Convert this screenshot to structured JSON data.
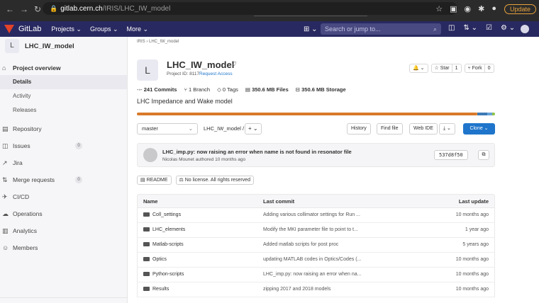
{
  "browser": {
    "url_host": "gitlab.cern.ch",
    "url_path": "/IRIS/LHC_IW_model",
    "update_label": "Update"
  },
  "header": {
    "brand": "GitLab",
    "menu": [
      "Projects ⌄",
      "Groups ⌄",
      "More ⌄"
    ],
    "search_placeholder": "Search or jump to..."
  },
  "sidebar": {
    "avatar_letter": "L",
    "project_name": "LHC_IW_model",
    "items": [
      {
        "label": "Project overview",
        "icon": "home-icon",
        "glyph": "⌂"
      },
      {
        "label": "Details"
      },
      {
        "label": "Activity"
      },
      {
        "label": "Releases"
      },
      {
        "label": "Repository",
        "icon": "doc-icon",
        "glyph": "▤"
      },
      {
        "label": "Issues",
        "icon": "issues-icon",
        "glyph": "◫",
        "count": "0"
      },
      {
        "label": "Jira",
        "icon": "external-link-icon",
        "glyph": "↗"
      },
      {
        "label": "Merge requests",
        "icon": "merge-request-icon",
        "glyph": "⇅",
        "count": "0"
      },
      {
        "label": "CI/CD",
        "icon": "rocket-icon",
        "glyph": "✈"
      },
      {
        "label": "Operations",
        "icon": "cloud-icon",
        "glyph": "☁"
      },
      {
        "label": "Analytics",
        "icon": "chart-icon",
        "glyph": "▥"
      },
      {
        "label": "Members",
        "icon": "users-icon",
        "glyph": "☺"
      }
    ]
  },
  "main": {
    "breadcrumb": "IRIS  ›  LHC_IW_model",
    "avatar_letter": "L",
    "title": "LHC_IW_model",
    "project_id": "Project ID: 8117",
    "request_access": "Request Access",
    "bell": "🔔 ⌄",
    "star_label": "☆ Star",
    "star_count": "1",
    "fork_label": "⑂ Fork",
    "fork_count": "0",
    "stats": {
      "commits": "241 Commits",
      "branches": "1 Branch",
      "tags": "0 Tags",
      "files": "350.6 MB Files",
      "storage": "350.6 MB Storage"
    },
    "description": "LHC Impedance and Wake model",
    "lang_colors": [
      "#d97a2b",
      "#d97a2b",
      "#3e7bb6",
      "#8fc44a"
    ],
    "branch": "master",
    "path": "LHC_IW_model  /",
    "plus": "+ ⌄",
    "buttons": {
      "history": "History",
      "find_file": "Find file",
      "web_ide": "Web IDE",
      "download": "⤓ ⌄",
      "clone": "Clone ⌄"
    },
    "commit": {
      "message": "LHC_imp.py: now raising an error when name is not found in resonator file",
      "author": "Nicolas Mounet",
      "meta": "authored 10 months ago",
      "sha": "537d8f50"
    },
    "readme_label": "README",
    "license_label": "No license. All rights reserved",
    "table": {
      "headers": [
        "Name",
        "Last commit",
        "Last update"
      ],
      "rows": [
        [
          "Coll_settings",
          "Adding various collimator settings for Run ...",
          "10 months ago"
        ],
        [
          "LHC_elements",
          "Modify the MKI parameter file to point to t...",
          "1 year ago"
        ],
        [
          "Matlab-scripts",
          "Added matlab scripts for post proc",
          "5 years ago"
        ],
        [
          "Optics",
          "updating MATLAB codes in Optics/Codes (...",
          "10 months ago"
        ],
        [
          "Python-scripts",
          "LHC_imp.py: now raising an error when na...",
          "10 months ago"
        ],
        [
          "Results",
          "zipping 2017 and 2018 models",
          "10 months ago"
        ]
      ]
    }
  }
}
